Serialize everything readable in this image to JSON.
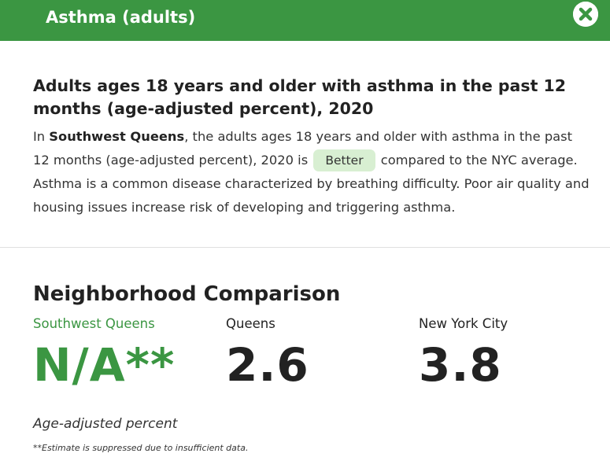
{
  "header": {
    "title": "Asthma (adults)",
    "close_icon": "close-icon"
  },
  "intro": {
    "title": "Adults ages 18 years and older with asthma in the past 12 months (age-adjusted percent), 2020",
    "text_prefix": "In ",
    "neighborhood": "Southwest Queens",
    "text_middle": ", the adults ages 18 years and older with asthma in the past 12 months (age-adjusted percent), 2020 is ",
    "rating": "Better",
    "text_suffix": " compared to the NYC average. Asthma is a common disease characterized by breathing difficulty. Poor air quality and housing issues increase risk of developing and triggering asthma."
  },
  "comparison": {
    "title": "Neighborhood Comparison",
    "columns": [
      {
        "label": "Southwest Queens",
        "value": "N/A**"
      },
      {
        "label": "Queens",
        "value": "2.6"
      },
      {
        "label": "New York City",
        "value": "3.8"
      }
    ],
    "unit_note": "Age-adjusted percent",
    "footnote": "**Estimate is suppressed due to insufficient data."
  },
  "colors": {
    "header_bg": "#3b9642",
    "highlight_green": "#3b9642",
    "badge_bg": "#d8efd2"
  }
}
